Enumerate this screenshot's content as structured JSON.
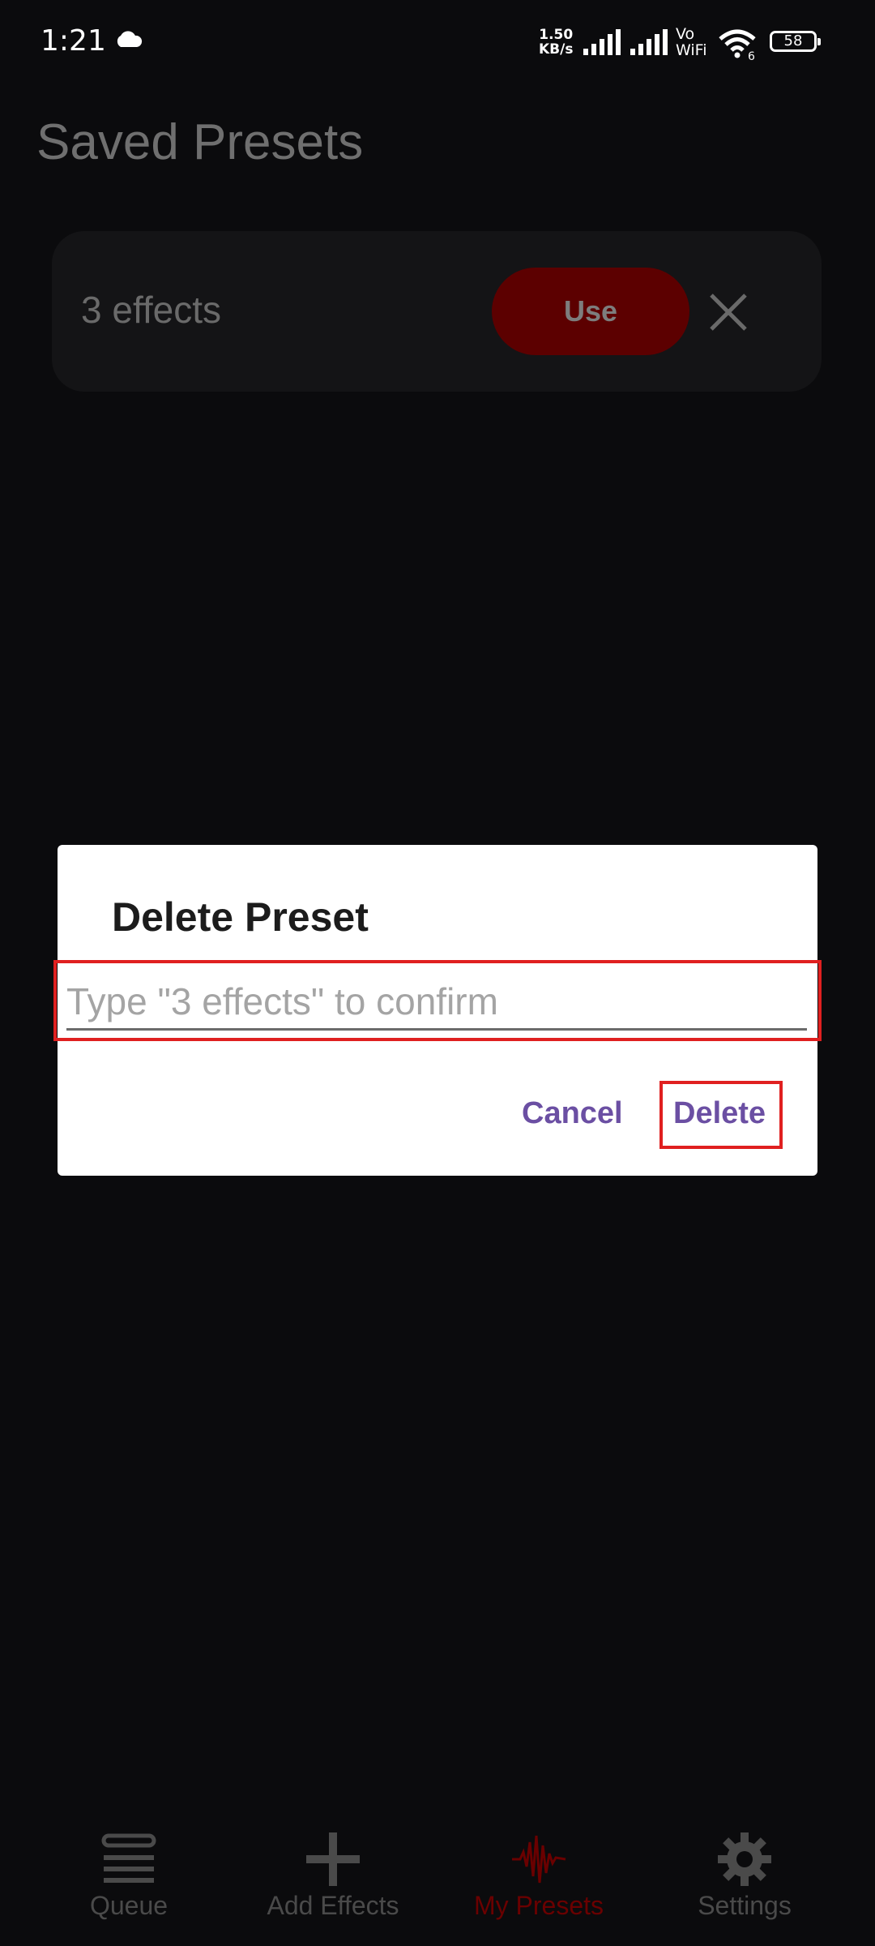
{
  "status_bar": {
    "time": "1:21",
    "net_speed_value": "1.50",
    "net_speed_unit": "KB/s",
    "vowifi_line1": "Vo",
    "vowifi_line2": "WiFi",
    "wifi_sub": "6",
    "battery": "58",
    "icons": [
      "cloud-icon",
      "signal-icon",
      "wifi-icon",
      "battery-icon"
    ]
  },
  "page": {
    "title": "Saved Presets"
  },
  "presets": [
    {
      "name": "3 effects",
      "use_label": "Use"
    }
  ],
  "dialog": {
    "title": "Delete Preset",
    "input_value": "",
    "input_placeholder": "Type \"3 effects\" to confirm",
    "cancel_label": "Cancel",
    "delete_label": "Delete",
    "button_color": "#6b4fa3",
    "highlight_color": "#e02020"
  },
  "nav": {
    "items": [
      {
        "label": "Queue",
        "icon": "queue-icon",
        "active": false
      },
      {
        "label": "Add Effects",
        "icon": "add-icon",
        "active": false
      },
      {
        "label": "My Presets",
        "icon": "waveform-icon",
        "active": true
      },
      {
        "label": "Settings",
        "icon": "gear-icon",
        "active": false
      }
    ],
    "active_color": "#6a0000"
  }
}
